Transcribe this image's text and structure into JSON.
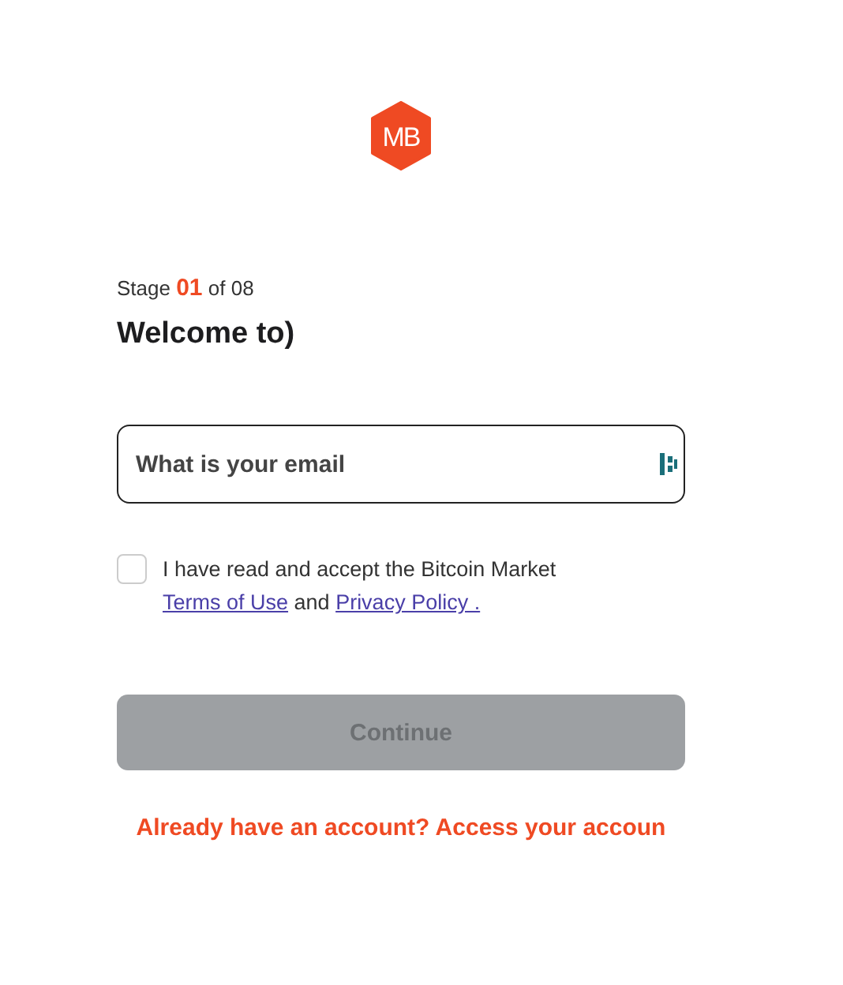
{
  "logo": {
    "text": "MB"
  },
  "stage": "Stage **01** of 08",
  "title": "Welcome to)",
  "email": {
    "placeholder": "What is your email"
  },
  "consent": {
    "checked": false,
    "parts": [
      {
        "kind": "text",
        "text": "I have read and accept the Bitcoin Market "
      },
      {
        "kind": "link",
        "text": "Terms of Use"
      },
      {
        "kind": "text",
        "text": " and "
      },
      {
        "kind": "link",
        "text": "Privacy Policy ."
      }
    ]
  },
  "continue_button": {
    "label": "Continue",
    "disabled": true
  },
  "login_link": "Already have an account? Access your accoun"
}
